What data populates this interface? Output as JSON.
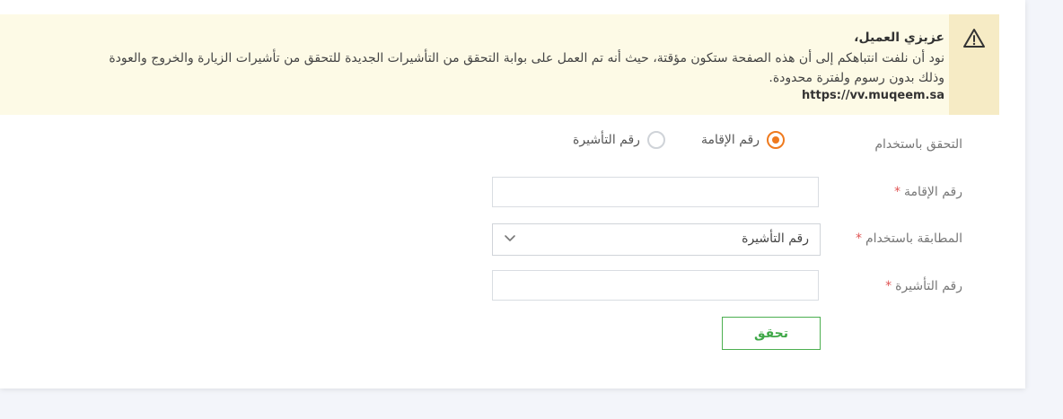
{
  "notice": {
    "icon": "warning-triangle-icon",
    "title": "عزيزي العميل،",
    "line1": "نود أن نلفت انتباهكم إلى أن هذه الصفحة ستكون مؤقتة، حيث أنه تم العمل على بوابة التحقق من التأشيرات الجديدة للتحقق من تأشيرات الزيارة والخروج والعودة",
    "line2": "وذلك بدون رسوم ولفترة محدودة.",
    "url": "https://vv.muqeem.sa"
  },
  "form": {
    "verify_using_label": "التحقق باستخدام",
    "radio_options": [
      {
        "label": "رقم الإقامة",
        "checked": true
      },
      {
        "label": "رقم التأشيرة",
        "checked": false
      }
    ],
    "iqama_label": "رقم الإقامة",
    "iqama_value": "",
    "match_using_label": "المطابقة باستخدام",
    "match_using_value": "رقم التأشيرة",
    "visa_label": "رقم التأشيرة",
    "visa_value": "",
    "required_mark": "*",
    "submit_label": "تحقق"
  },
  "colors": {
    "accent_orange": "#ef7a1e",
    "success_green": "#3fa848",
    "required_red": "#e05555",
    "notice_bg": "#fdfae6"
  }
}
